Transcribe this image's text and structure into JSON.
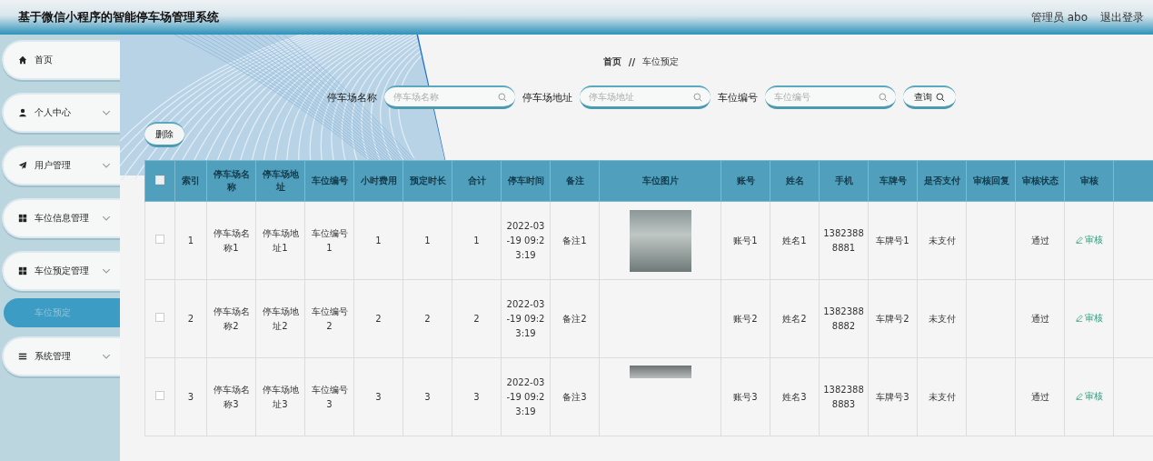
{
  "header": {
    "title": "基于微信小程序的智能停车场管理系统",
    "user": "管理员 abo",
    "logout": "退出登录"
  },
  "sidebar": {
    "items": [
      {
        "label": "首页",
        "kind": "link"
      },
      {
        "label": "个人中心",
        "kind": "menu"
      },
      {
        "label": "用户管理",
        "kind": "menu"
      },
      {
        "label": "车位信息管理",
        "kind": "menu"
      },
      {
        "label": "车位预定管理",
        "kind": "menu",
        "children": [
          {
            "label": "车位预定",
            "selected": true
          }
        ]
      },
      {
        "label": "系统管理",
        "kind": "menu"
      }
    ]
  },
  "breadcrumb": {
    "home": "首页",
    "separator": "//",
    "current": "车位预定"
  },
  "search": {
    "fields": [
      {
        "label": "停车场名称",
        "placeholder": "停车场名称"
      },
      {
        "label": "停车场地址",
        "placeholder": "停车场地址"
      },
      {
        "label": "车位编号",
        "placeholder": "车位编号"
      }
    ],
    "button": "查询"
  },
  "delete_button": "删除",
  "table": {
    "all_checked": false,
    "columns": [
      "索引",
      "停车场名称",
      "停车场地址",
      "车位编号",
      "小时费用",
      "预定时长",
      "合计",
      "停车时间",
      "备注",
      "车位图片",
      "账号",
      "姓名",
      "手机",
      "车牌号",
      "是否支付",
      "审核回复",
      "审核状态",
      "审核"
    ],
    "rows": [
      {
        "selected": false,
        "cells": [
          "1",
          "停车场名称1",
          "停车场地址1",
          "车位编号1",
          "1",
          "1",
          "1",
          "2022-03-19 09:23:19",
          "备注1"
        ],
        "kind": "photo",
        "cells2": [
          "账号1",
          "姓名1",
          "13823888881",
          "车牌号1",
          "未支付"
        ],
        "status": "通过",
        "action": "审核"
      },
      {
        "selected": false,
        "cells": [
          "2",
          "停车场名称2",
          "停车场地址2",
          "车位编号2",
          "2",
          "2",
          "2",
          "2022-03-19 09:23:19",
          "备注2"
        ],
        "kind": "blank",
        "cells2": [
          "账号2",
          "姓名2",
          "13823888882",
          "车牌号2",
          "未支付"
        ],
        "status": "通过",
        "action": "审核"
      },
      {
        "selected": false,
        "cells": [
          "3",
          "停车场名称3",
          "停车场地址3",
          "车位编号3",
          "3",
          "3",
          "3",
          "2022-03-19 09:23:19",
          "备注3"
        ],
        "kind": "strip",
        "cells2": [
          "账号3",
          "姓名3",
          "13823888883",
          "车牌号3",
          "未支付"
        ],
        "status": "通过",
        "action": "审核"
      }
    ]
  }
}
